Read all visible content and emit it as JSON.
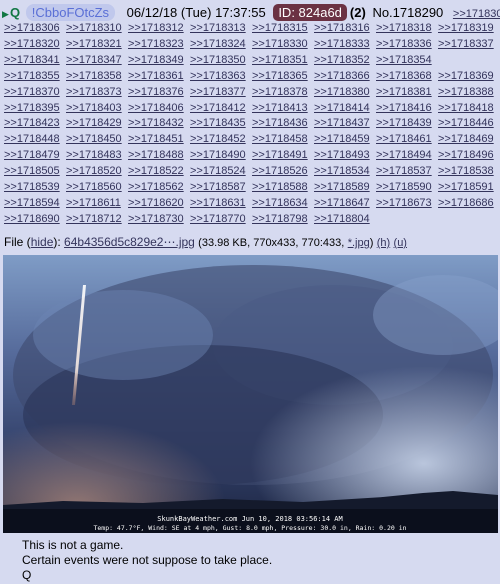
{
  "post": {
    "marker": "Q",
    "tripcode": "!CbboFOtcZs",
    "date": "06/12/18 (Tue) 17:37:55",
    "id_label": "ID: 824a6d",
    "reply_count": "(2)",
    "number_prefix": "No.",
    "number": "1718290"
  },
  "backlinks": [
    ">>1718302",
    ">>1718306",
    ">>1718310",
    ">>1718312",
    ">>1718313",
    ">>1718315",
    ">>1718316",
    ">>1718318",
    ">>1718319",
    ">>1718320",
    ">>1718321",
    ">>1718323",
    ">>1718324",
    ">>1718330",
    ">>1718333",
    ">>1718336",
    ">>1718337",
    ">>1718341",
    ">>1718347",
    ">>1718349",
    ">>1718350",
    ">>1718351",
    ">>1718352",
    ">>1718354",
    ">>1718355",
    ">>1718358",
    ">>1718361",
    ">>1718363",
    ">>1718365",
    ">>1718366",
    ">>1718368",
    ">>1718369",
    ">>1718370",
    ">>1718373",
    ">>1718376",
    ">>1718377",
    ">>1718378",
    ">>1718380",
    ">>1718381",
    ">>1718388",
    ">>1718395",
    ">>1718403",
    ">>1718406",
    ">>1718412",
    ">>1718413",
    ">>1718414",
    ">>1718416",
    ">>1718418",
    ">>1718423",
    ">>1718429",
    ">>1718432",
    ">>1718435",
    ">>1718436",
    ">>1718437",
    ">>1718439",
    ">>1718446",
    ">>1718448",
    ">>1718450",
    ">>1718451",
    ">>1718452",
    ">>1718458",
    ">>1718459",
    ">>1718461",
    ">>1718469",
    ">>1718479",
    ">>1718483",
    ">>1718488",
    ">>1718490",
    ">>1718491",
    ">>1718493",
    ">>1718494",
    ">>1718496",
    ">>1718505",
    ">>1718520",
    ">>1718522",
    ">>1718524",
    ">>1718526",
    ">>1718534",
    ">>1718537",
    ">>1718538",
    ">>1718539",
    ">>1718560",
    ">>1718562",
    ">>1718587",
    ">>1718588",
    ">>1718589",
    ">>1718590",
    ">>1718591",
    ">>1718594",
    ">>1718611",
    ">>1718620",
    ">>1718631",
    ">>1718634",
    ">>1718647",
    ">>1718673",
    ">>1718686",
    ">>1718690",
    ">>1718712",
    ">>1718730",
    ">>1718770",
    ">>1718798",
    ">>1718804"
  ],
  "file": {
    "label": "File",
    "hide_label": "hide",
    "filename": "64b4356d5c829e2⋯.jpg",
    "meta": "(33.98 KB, 770x433, 770:433,",
    "ext_link": "*.jpg",
    "h_link": "(h)",
    "u_link": "(u)"
  },
  "image": {
    "caption_line1": "SkunkBayWeather.com  Jun 10, 2018  03:56:14 AM",
    "caption_line2": "Temp:  47.7°F, Wind: SE  at    4 mph, Gust:  8.0 mph, Pressure:  30.0 in, Rain: 0.20 in"
  },
  "message": [
    "This is not a game.",
    "Certain events were not suppose to take place.",
    "Q"
  ],
  "colors": {
    "background": "#d6daf0",
    "link": "#34345c",
    "name": "#117743",
    "id_badge": "#6b3243"
  }
}
